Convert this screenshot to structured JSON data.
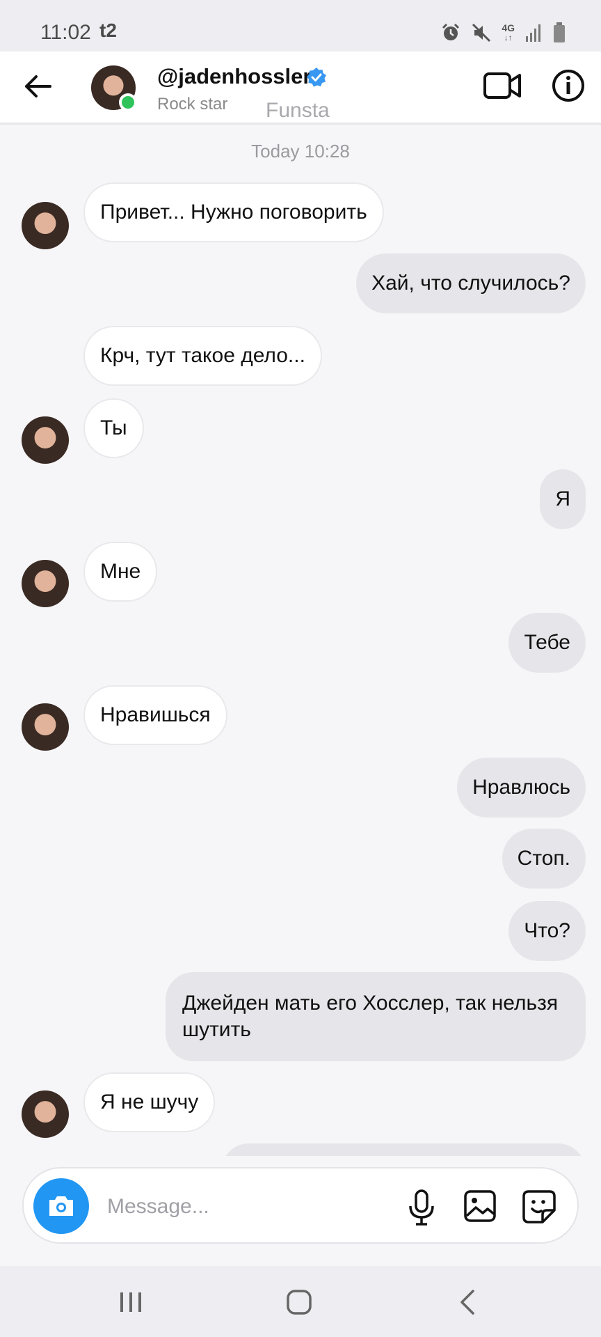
{
  "status_bar": {
    "time": "11:02",
    "carrier": "t2",
    "network": "4G"
  },
  "header": {
    "username": "@jadenhossler",
    "subtitle": "Rock star",
    "mode_label": "Funsta",
    "online_color": "#2ec35b",
    "verified_color": "#3897f0"
  },
  "chat": {
    "timestamp": "Today 10:28",
    "messages": [
      {
        "side": "in",
        "text": "Привет... Нужно поговорить",
        "avatar": true
      },
      {
        "side": "out",
        "text": "Хай, что случилось?"
      },
      {
        "side": "in",
        "text": "Крч, тут такое дело...",
        "avatar": false
      },
      {
        "side": "in",
        "text": "Ты",
        "avatar": true
      },
      {
        "side": "out",
        "text": "Я"
      },
      {
        "side": "in",
        "text": "Мне",
        "avatar": true
      },
      {
        "side": "out",
        "text": "Тебе"
      },
      {
        "side": "in",
        "text": "Нравишься",
        "avatar": true
      },
      {
        "side": "out",
        "text": "Нравлюсь"
      },
      {
        "side": "out",
        "text": "Стоп."
      },
      {
        "side": "out",
        "text": "Что?"
      },
      {
        "side": "out",
        "text": "Джейден мать его Хосслер, так нельзя шутить"
      },
      {
        "side": "in",
        "text": "Я не шучу",
        "avatar": true
      }
    ]
  },
  "composer": {
    "placeholder": "Message...",
    "camera_color": "#2196f3"
  },
  "icons": {
    "back": "arrow-left-icon",
    "video": "video-camera-icon",
    "info": "info-icon",
    "camera": "camera-icon",
    "mic": "microphone-icon",
    "gallery": "image-icon",
    "sticker": "sticker-icon"
  }
}
